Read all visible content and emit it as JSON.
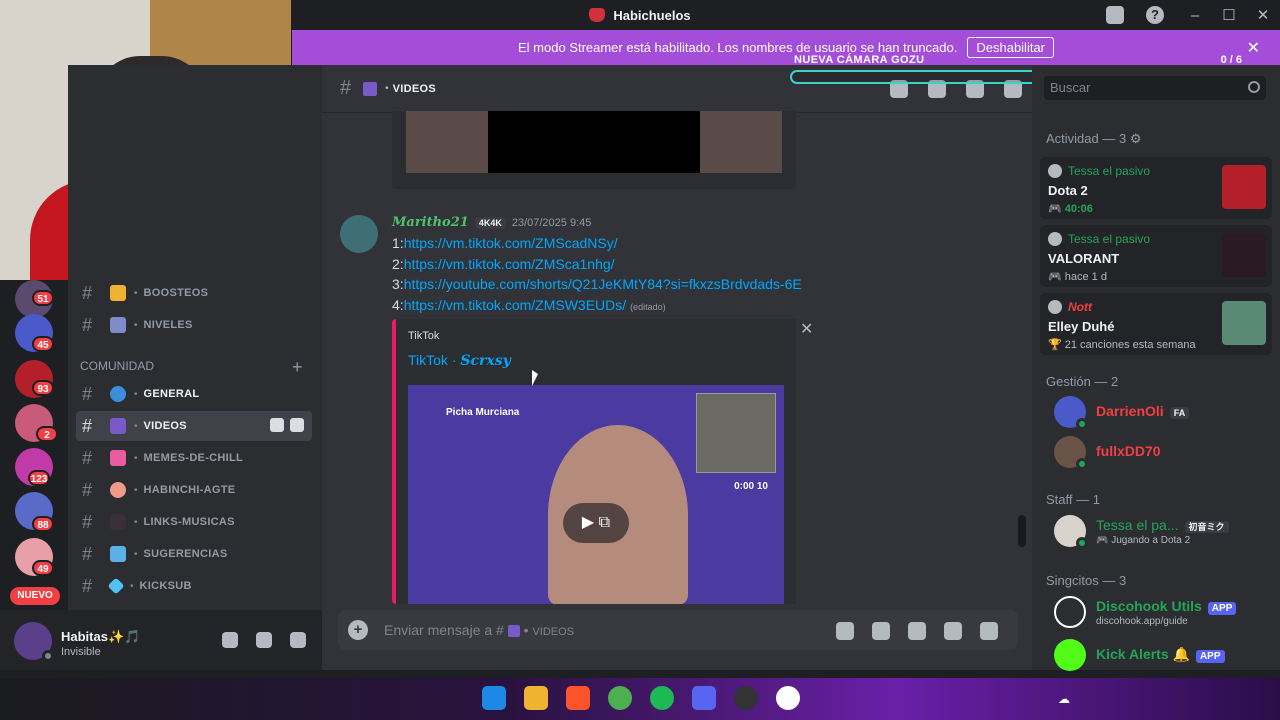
{
  "window": {
    "title": "Habichuelos"
  },
  "banner": {
    "text": "El modo Streamer está habilitado. Los nombres de usuario se han truncado.",
    "button": "Deshabilitar"
  },
  "overlay": {
    "label": "NUEVA CÁMARA GOZU",
    "counter": "0 / 6"
  },
  "webcam": {
    "badge": "2"
  },
  "guilds": [
    {
      "badge": "51"
    },
    {
      "badge": "45"
    },
    {
      "badge": "93"
    },
    {
      "badge": "2"
    },
    {
      "badge": "123"
    },
    {
      "badge": "88"
    },
    {
      "badge": "49"
    }
  ],
  "guild_new": "NUEVO",
  "channels_top": [
    {
      "name": "BOOSTEOS",
      "color": "#f0b232"
    },
    {
      "name": "NIVELES",
      "color": "#7f8cc9"
    }
  ],
  "category": "COMUNIDAD",
  "channels": [
    {
      "name": "GENERAL",
      "color": "#3a8fd8"
    },
    {
      "name": "VIDEOS",
      "color": "#7a5ac8"
    },
    {
      "name": "MEMES-DE-CHILL",
      "color": "#e85ca0"
    },
    {
      "name": "HABINCHI-AGTE",
      "color": "#f29a88"
    },
    {
      "name": "LINKS-MUSICAS",
      "color": "#3a2e3a"
    },
    {
      "name": "SUGERENCIAS",
      "color": "#5ab0e8"
    },
    {
      "name": "KICKSUB",
      "color": "#4fc3f7"
    }
  ],
  "user": {
    "name": "Habitas✨🎵",
    "status": "Invisible"
  },
  "header": {
    "channel": "VIDEOS"
  },
  "message": {
    "author": "Maritho21",
    "tag": "4K4K",
    "time": "23/07/2025 9:45",
    "links": [
      {
        "prefix": "1:",
        "url": "https://vm.tiktok.com/ZMScadNSy/"
      },
      {
        "prefix": "2:",
        "url": "https://vm.tiktok.com/ZMSca1nhg/"
      },
      {
        "prefix": "3:",
        "url": "https://youtube.com/shorts/Q21JeKMtY84?si=fkxzsBrdvdads-6E"
      },
      {
        "prefix": "4:",
        "url": "https://vm.tiktok.com/ZMSW3EUDs/"
      }
    ],
    "edited": "(editado)"
  },
  "embed": {
    "provider": "TikTok",
    "title_prefix": "TikTok · ",
    "title_name": "Scrxsy",
    "video_label": "Picha Murciana",
    "video_stats": "0:00   10",
    "play": "▶ ⧉"
  },
  "composer": {
    "placeholder": "Enviar mensaje a #",
    "channel": "VIDEOS"
  },
  "search": {
    "placeholder": "Buscar"
  },
  "activity": {
    "title": "Actividad — 3",
    "cards": [
      {
        "user": "Tessa el pasivo",
        "game": "Dota 2",
        "meta": "40:06",
        "art_color": "#b3202a"
      },
      {
        "user": "Tessa el pasivo",
        "game": "VALORANT",
        "meta": "hace 1 d",
        "art_color": "#2a1a22"
      },
      {
        "user": "Nott",
        "game": "Elley Duhé",
        "meta": "21 canciones esta semana",
        "art_color": "#5a8a74"
      }
    ]
  },
  "sections": {
    "gestion": "Gestión — 2",
    "staff": "Staff — 1",
    "singcitos": "Singcitos — 3"
  },
  "members": [
    {
      "name": "DarrienOli",
      "tag": "FA",
      "color": "#f23f43"
    },
    {
      "name": "fullxDD70",
      "tag": "",
      "color": "#f23f43"
    },
    {
      "name": "Tessa el pa...",
      "tag": "初音ミク",
      "color": "#23a559",
      "sub": "Jugando a Dota 2"
    },
    {
      "name": "Discohook Utils",
      "tag": "APP",
      "color": "#23a559",
      "sub": "discohook.app/guide"
    },
    {
      "name": "Kick Alerts 🔔",
      "tag": "APP",
      "color": "#23a559"
    }
  ]
}
